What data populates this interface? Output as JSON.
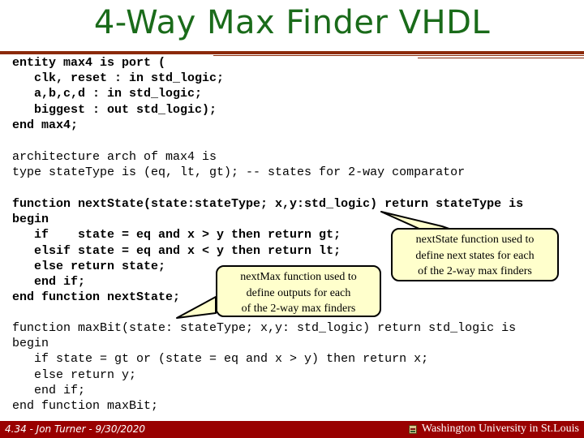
{
  "slide": {
    "title": "4-Way Max Finder VHDL",
    "colors": {
      "title": "#1a6b1a",
      "rule": "#8b2a0a",
      "callout_fill": "#ffffcc",
      "footer_bg": "#990000"
    }
  },
  "code": {
    "entity": "entity max4 is port (\n   clk, reset : in std_logic;\n   a,b,c,d : in std_logic;\n   biggest : out std_logic);\nend max4;",
    "architecture": "architecture arch of max4 is\ntype stateType is (eq, lt, gt); -- states for 2-way comparator",
    "next_state": "function nextState(state:stateType; x,y:std_logic) return stateType is\nbegin\n   if    state = eq and x > y then return gt;\n   elsif state = eq and x < y then return lt;\n   else return state;\n   end if;\nend function nextState;",
    "max_bit": "function maxBit(state: stateType; x,y: std_logic) return std_logic is\nbegin\n   if state = gt or (state = eq and x > y) then return x;\n   else return y;\n   end if;\nend function maxBit;"
  },
  "callouts": {
    "next_state": [
      "nextState function used to",
      "define next states for each",
      "of the 2-way max finders"
    ],
    "next_max": [
      "nextMax function used to",
      "define outputs for each",
      "of the 2-way max finders"
    ]
  },
  "footer": {
    "left": "4.34 - Jon Turner - 9/30/2020",
    "right": "Washington University in St.Louis",
    "logo_icon": "university-crest-icon"
  }
}
